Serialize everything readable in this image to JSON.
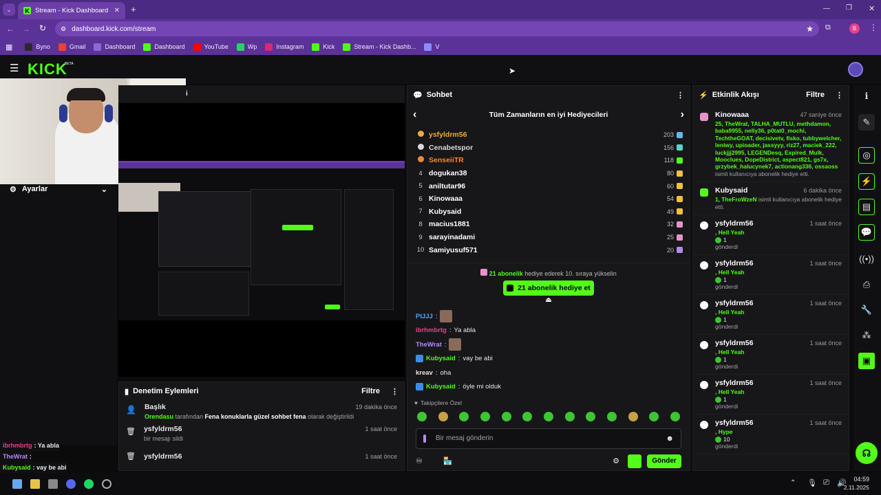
{
  "browser": {
    "tab_title": "Stream - Kick Dashboard",
    "url": "dashboard.kick.com/stream",
    "profile_letter": "B",
    "bookmarks": [
      {
        "label": "Byno",
        "color": "#2a2a2a"
      },
      {
        "label": "Gmail",
        "color": "#ea4335"
      },
      {
        "label": "Dashboard",
        "color": "#8a6ad0"
      },
      {
        "label": "Dashboard",
        "color": "#53fc18"
      },
      {
        "label": "YouTube",
        "color": "#ff0000"
      },
      {
        "label": "Wp",
        "color": "#25d366"
      },
      {
        "label": "Instagram",
        "color": "#d62976"
      },
      {
        "label": "Kick",
        "color": "#53fc18"
      },
      {
        "label": "Stream - Kick Dashb...",
        "color": "#53fc18"
      },
      {
        "label": "V",
        "color": "#8a8aff"
      }
    ]
  },
  "header": {
    "logo": "KICK",
    "beta": "BETA"
  },
  "settings": {
    "label": "Ayarlar"
  },
  "preview": {
    "title_fragment": "i"
  },
  "moderation": {
    "title": "Denetim Eylemleri",
    "filter": "Filtre",
    "items": [
      {
        "user": "Başlık",
        "time": "19 dakika önce",
        "line_user": "Orendasu",
        "line_mid": " tarafından ",
        "line_bold": "Fena konuklarla güzel sohbet fena",
        "line_end": " olarak değiştirildi"
      },
      {
        "user": "ysfyldrm56",
        "time": "1 saat önce",
        "detail": "bir mesajı sildi"
      },
      {
        "user": "ysfyldrm56",
        "time": "1 saat önce"
      }
    ]
  },
  "chat": {
    "title": "Sohbet",
    "leaderboard_title": "Tüm Zamanların en iyi Hediyecileri",
    "leaders": [
      {
        "rank": "",
        "name": "ysfyldrm56",
        "value": "203",
        "color": "#f0a838",
        "gift": "#6ab4e8"
      },
      {
        "rank": "",
        "name": "Cenabetspor",
        "value": "156",
        "color": "#d8d8d8",
        "gift": "#5ad4c8"
      },
      {
        "rank": "",
        "name": "SenseiiTR",
        "value": "118",
        "color": "#f08838",
        "gift": "#53fc18"
      },
      {
        "rank": "4",
        "name": "dogukan38",
        "value": "80",
        "color": "#ffffff",
        "gift": "#f0c040"
      },
      {
        "rank": "5",
        "name": "aniltutar96",
        "value": "60",
        "color": "#ffffff",
        "gift": "#f0c040"
      },
      {
        "rank": "6",
        "name": "Kinowaaa",
        "value": "54",
        "color": "#ffffff",
        "gift": "#f0c040"
      },
      {
        "rank": "7",
        "name": "Kubysaid",
        "value": "49",
        "color": "#ffffff",
        "gift": "#f0c040"
      },
      {
        "rank": "8",
        "name": "macius1881",
        "value": "32",
        "color": "#ffffff",
        "gift": "#e893c8"
      },
      {
        "rank": "9",
        "name": "sarayinadami",
        "value": "25",
        "color": "#ffffff",
        "gift": "#e893c8"
      },
      {
        "rank": "10",
        "name": "Samiyusuf571",
        "value": "20",
        "color": "#ffffff",
        "gift": "#b48ae8"
      }
    ],
    "promo_count": "21 abonelik",
    "promo_text": " hediye ederek 10. sıraya yükselin",
    "promo_button": "21 abonelik hediye et",
    "messages": [
      {
        "user": "PIJJJ",
        "text": "",
        "color": "#4aa8ff"
      },
      {
        "user": "ibrhmbrtg",
        "text": "Ya abla",
        "color": "#e8408a"
      },
      {
        "user": "TheWrat",
        "text": "",
        "color": "#b48aff"
      },
      {
        "user": "Kubysaid",
        "text": "vay be abi",
        "color": "#53fc18"
      },
      {
        "user": "kreav",
        "text": "oha",
        "color": "#e8e8e8"
      },
      {
        "user": "Kubysaid",
        "text": "öyle mi olduk",
        "color": "#53fc18"
      }
    ],
    "followers_only": "Takipçilere Özel",
    "input_placeholder": "Bir mesaj gönderin",
    "send": "Gönder"
  },
  "activity": {
    "title": "Etkinlik Akışı",
    "filter": "Filtre",
    "first": {
      "user": "Kinowaaa",
      "time": "47 saniye önce",
      "names": "25, TheWrat, TALHA_MUTLU, methdamon, baba9955, nelly36, p0tat0_mochi, TechtheGOAT, decisivetv, fisko, tubbywelcher, leniwy, upioader, jassyyy, riz27, maciek_222, luckjjj2995, LEGENDesq, Expired_Mulk, Mooclues, DopeDistrict, aspect821, gs7x, grzybek_halucynek7, actionang336, ossaoss",
      "text": "isimli kullanıcıya abonelik hediye etti."
    },
    "second": {
      "user": "Kubysaid",
      "time": "6 dakika önce",
      "names": "1, TheFroWzeN",
      "text": " isimli kullanıcıya abonelik hediye etti."
    },
    "items": [
      {
        "user": "ysfyldrm56",
        "time": "1 saat önce",
        "item": ", Hell Yeah",
        "count": "1",
        "sent": "gönderdi"
      },
      {
        "user": "ysfyldrm56",
        "time": "1 saat önce",
        "item": ", Hell Yeah",
        "count": "1",
        "sent": "gönderdi"
      },
      {
        "user": "ysfyldrm56",
        "time": "1 saat önce",
        "item": ", Hell Yeah",
        "count": "1",
        "sent": "gönderdi"
      },
      {
        "user": "ysfyldrm56",
        "time": "1 saat önce",
        "item": ", Hell Yeah",
        "count": "1",
        "sent": "gönderdi"
      },
      {
        "user": "ysfyldrm56",
        "time": "1 saat önce",
        "item": ", Hell Yeah",
        "count": "1",
        "sent": "gönderdi"
      },
      {
        "user": "ysfyldrm56",
        "time": "1 saat önce",
        "item": ", Hype",
        "count": "10",
        "sent": "gönderdi"
      }
    ]
  },
  "overlay_chat": [
    {
      "user": "ibrhmbrtg",
      "text": ": Ya abla",
      "color": "#e8408a"
    },
    {
      "user": "TheWrat",
      "text": " :",
      "color": "#b48aff"
    },
    {
      "user": "Kubysaid",
      "text": ": vay be abi",
      "color": "#53fc18"
    },
    {
      "user": "kreav",
      "text": ": oha",
      "color": "#ffffff"
    },
    {
      "user": "Kubysaid",
      "text": ": öyle mi olduk",
      "color": "#53fc18"
    }
  ],
  "taskbar": {
    "time": "04:59",
    "date": "2.11.2025"
  }
}
